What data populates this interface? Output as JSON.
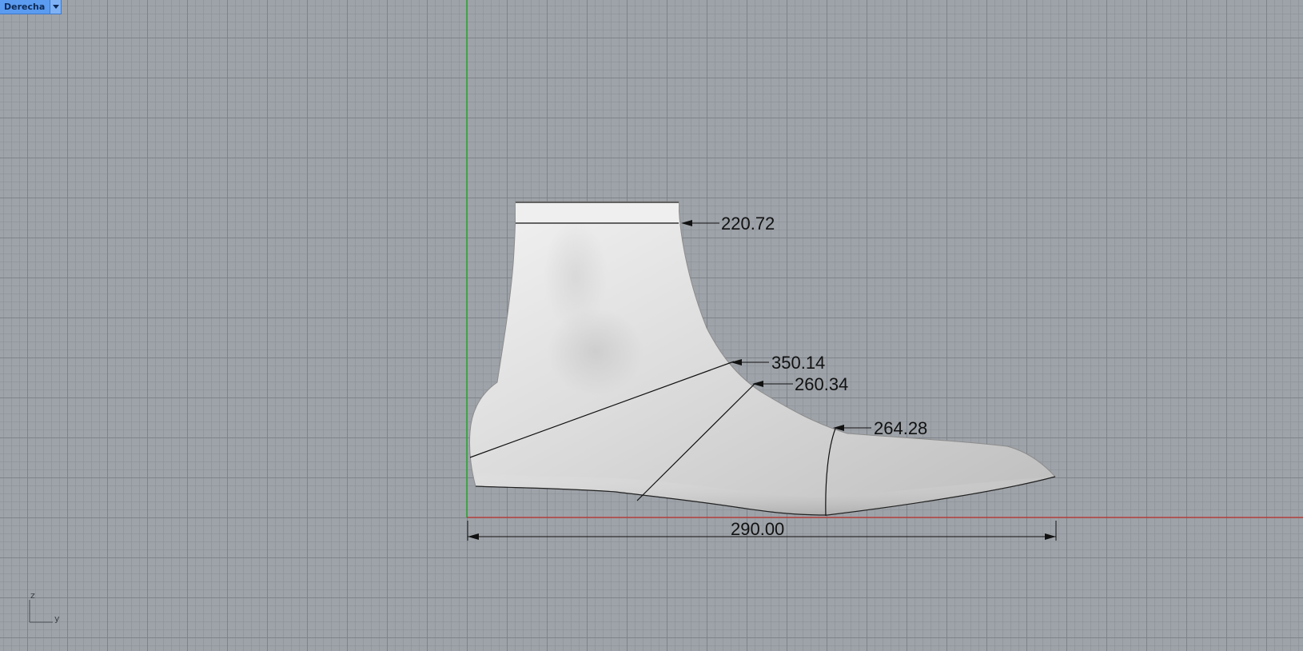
{
  "viewport": {
    "title": "Derecha",
    "dropdown_icon": "triangle-down-icon"
  },
  "dimensions": {
    "top_opening": "220.72",
    "instep_diagonal": "350.14",
    "instep_girth": "260.34",
    "ball_girth": "264.28",
    "overall_length": "290.00"
  },
  "axis_widget": {
    "z_label": "z",
    "y_label": "y"
  },
  "colors": {
    "background": "#9ea3a9",
    "x_axis": "#c0322d",
    "z_axis": "#2fa336",
    "tab_active": "#5b9bf0"
  }
}
